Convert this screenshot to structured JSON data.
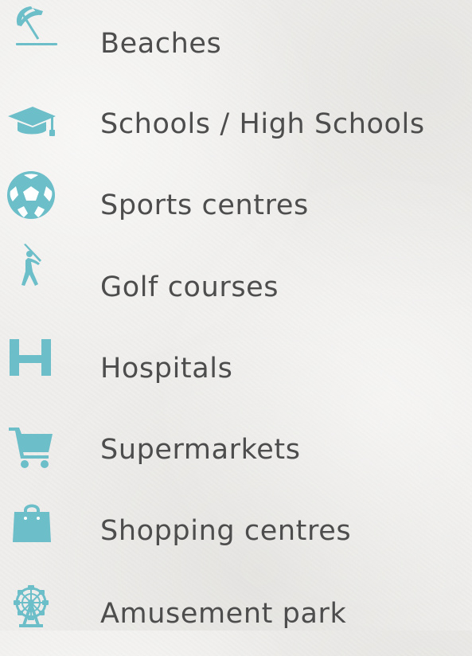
{
  "amenities": [
    {
      "icon": "beach-umbrella-icon",
      "label": "Beaches"
    },
    {
      "icon": "graduation-cap-icon",
      "label": "Schools / High Schools"
    },
    {
      "icon": "soccer-ball-icon",
      "label": "Sports centres"
    },
    {
      "icon": "golfer-icon",
      "label": "Golf courses"
    },
    {
      "icon": "hospital-h-icon",
      "label": "Hospitals"
    },
    {
      "icon": "shopping-cart-icon",
      "label": "Supermarkets"
    },
    {
      "icon": "shopping-bag-icon",
      "label": "Shopping centres"
    },
    {
      "icon": "ferris-wheel-icon",
      "label": "Amusement park"
    }
  ],
  "colors": {
    "icon": "#6cbec9",
    "text": "#4d4d4d",
    "background": "#efeeec"
  }
}
